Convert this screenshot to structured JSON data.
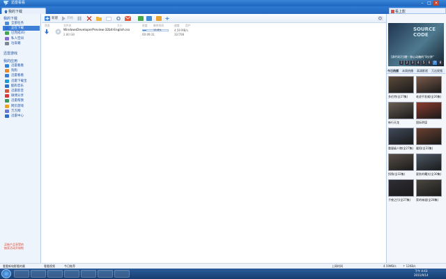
{
  "app": {
    "title": "迅雷看看"
  },
  "tabs": {
    "download": "我的下载",
    "right": "看上影"
  },
  "sidebar": {
    "section1": "我的下载",
    "items1": [
      {
        "label": "全部任务",
        "color": "#4c8ddb"
      },
      {
        "label": "正在下载",
        "color": "#2e73d2"
      },
      {
        "label": "已完成(6)",
        "color": "#41a84b"
      },
      {
        "label": "私人空间",
        "color": "#8a6bd1"
      },
      {
        "label": "垃圾箱",
        "color": "#7a8794"
      }
    ],
    "section2": "迅雷游戏",
    "section3": "我的应用",
    "items3": [
      {
        "label": "迅雷看看",
        "color": "#2f86d9"
      },
      {
        "label": "狗狗",
        "color": "#e58a2f"
      },
      {
        "label": "迅雷看看",
        "color": "#3b7fd4"
      },
      {
        "label": "迅雷下载宝",
        "color": "#1f9bd6"
      },
      {
        "label": "酷狗音乐",
        "color": "#2c74c7"
      },
      {
        "label": "迅雷影音",
        "color": "#d35a3b"
      },
      {
        "label": "微博分享",
        "color": "#d8393b"
      },
      {
        "label": "迅雷帮我",
        "color": "#3a9a5b"
      },
      {
        "label": "网页游戏",
        "color": "#f0a31c"
      },
      {
        "label": "万方网",
        "color": "#6b7bd4"
      },
      {
        "label": "迅雷中心",
        "color": "#2d6fc8"
      }
    ],
    "promo": "买新产品享受的 抽奖活动开始啦"
  },
  "toolbar": {
    "new_label": "新建",
    "start_label": "开始",
    "icons": [
      "pause-icon",
      "delete-icon",
      "folder-icon",
      "share-icon",
      "mail-icon",
      "more-icon"
    ]
  },
  "list": {
    "columns": [
      "状态",
      "文件名",
      "大小",
      "进度",
      "剩余时间",
      "速度",
      "用户"
    ],
    "rows": [
      {
        "name": "WindowsDeveloperPreview-32bit-English.iso",
        "size": "2.80 GB",
        "progress": 0.13,
        "progress_text": "13.8%",
        "time_left": "00:09:31",
        "speed": "4.59 MB/s",
        "peers": "32/708"
      }
    ]
  },
  "right_panel": {
    "banner_title": "SOURCE CODE",
    "banner_caption": "[源代码]引爆！惊心动魄的“8分钟”",
    "pages": [
      "1",
      "2",
      "3",
      "4",
      "5",
      "6",
      "7",
      "8"
    ],
    "active_page": 6,
    "tabs": [
      "今日热播",
      "本周热播",
      "高清影视",
      "万达视频"
    ],
    "items": [
      {
        "caption": "多伦特(全27集)",
        "color": "#5b4a3a"
      },
      {
        "caption": "老虎不发威(全26集)",
        "color": "#7a5a4a"
      },
      {
        "caption": "新行天龙",
        "color": "#6a5f55"
      },
      {
        "caption": "国际阴谋",
        "color": "#8a3b2e"
      },
      {
        "caption": "重量级人物(全27集)",
        "color": "#3f4a5a"
      },
      {
        "caption": "暖阳(全31集)",
        "color": "#6a4030"
      },
      {
        "caption": "拐角(全32集)",
        "color": "#585048"
      },
      {
        "caption": "夏秋的曙光(全30集)",
        "color": "#4d5865"
      },
      {
        "caption": "子夜之行(全27集)",
        "color": "#2e2e35"
      },
      {
        "caption": "家的味道(全28集)",
        "color": "#4a4640"
      }
    ]
  },
  "statusbar": {
    "left1": "看看新电影看的最",
    "left2": "看看视频",
    "left3": "今日推荐",
    "right1": "上网时间",
    "right2": "4.59MB/s",
    "right3": "↑ 12KB/s"
  },
  "taskbar": {
    "time": "下午 4:43",
    "date": "2011/9/14"
  }
}
